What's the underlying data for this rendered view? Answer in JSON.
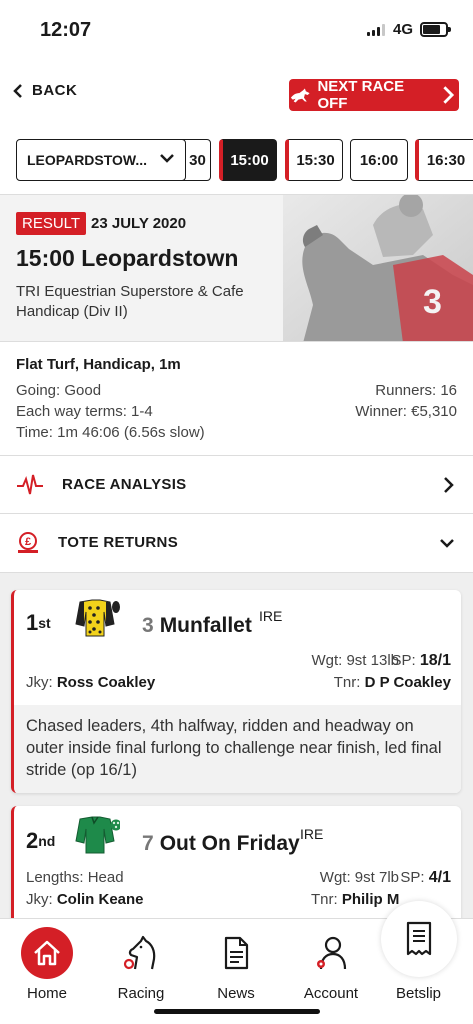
{
  "status_bar": {
    "time": "12:07",
    "network": "4G"
  },
  "header": {
    "back_label": "BACK",
    "next_race_label": "NEXT RACE OFF"
  },
  "race_selector": {
    "course": "LEOPARDSTOW...",
    "times": [
      {
        "label": "30",
        "active": false
      },
      {
        "label": "15:00",
        "active": true
      },
      {
        "label": "15:30",
        "active": false
      },
      {
        "label": "16:00",
        "active": false
      },
      {
        "label": "16:30",
        "active": false
      }
    ]
  },
  "race": {
    "badge": "RESULT",
    "date": "23 JULY 2020",
    "title": "15:00 Leopardstown",
    "name": "TRI Equestrian Superstore & Cafe Handicap (Div II)",
    "type": "Flat Turf, Handicap, 1m",
    "going": "Going: Good",
    "each_way": "Each way terms: 1-4",
    "time": "Time: 1m 46:06 (6.56s slow)",
    "runners": "Runners: 16",
    "winner": "Winner: €5,310"
  },
  "accordions": {
    "race_analysis": "RACE ANALYSIS",
    "tote_returns": "TOTE RETURNS"
  },
  "results": [
    {
      "position": "1",
      "suffix": "st",
      "number": "3",
      "horse": "Munfallet",
      "country": "IRE",
      "weight_label": "Wgt:",
      "weight": "9st 13lb",
      "sp_label": "SP:",
      "sp": "18/1",
      "jockey_label": "Jky:",
      "jockey": "Ross Coakley",
      "trainer_label": "Tnr:",
      "trainer": "D P Coakley",
      "comment": "Chased leaders, 4th halfway, ridden and headway on outer inside final furlong to challenge near finish, led final stride (op 16/1)"
    },
    {
      "position": "2",
      "suffix": "nd",
      "number": "7",
      "horse": "Out On Friday",
      "country": "IRE",
      "lengths": "Lengths: Head",
      "weight_label": "Wgt:",
      "weight": "9st 7lb",
      "sp_label": "SP:",
      "sp": "4/1",
      "jockey_label": "Jky:",
      "jockey": "Colin Keane",
      "trainer_label": "Tnr:",
      "trainer": "Philip M"
    }
  ],
  "bottom_nav": {
    "home": "Home",
    "racing": "Racing",
    "news": "News",
    "account": "Account",
    "betslip": "Betslip"
  },
  "colors": {
    "accent": "#d41f26",
    "dark": "#1a1a1a"
  }
}
